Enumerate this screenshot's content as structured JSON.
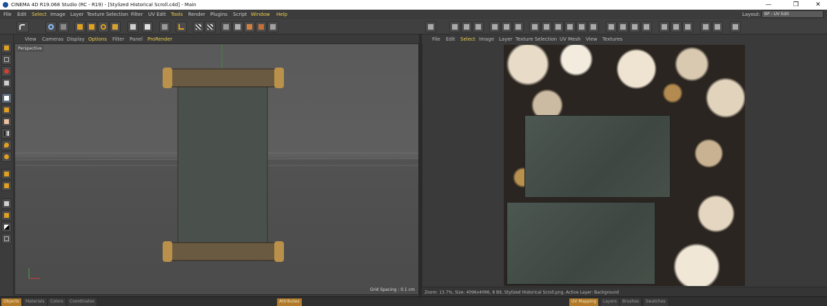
{
  "titlebar": {
    "title": "CINEMA 4D R19.068 Studio (RC - R19) - [Stylized Historical Scroll.c4d] - Main",
    "minimize": "—",
    "restore": "❐",
    "close": "✕"
  },
  "menubar": {
    "items": [
      "File",
      "Edit",
      "Select",
      "Image",
      "Layer",
      "Texture Selection",
      "Filter",
      "UV Edit",
      "Tools",
      "Render",
      "Plugins",
      "Script",
      "Window",
      "Help"
    ],
    "layout_label": "Layout:",
    "layout_value": "BP - UV Edit"
  },
  "viewport": {
    "menu": [
      "View",
      "Cameras",
      "Display",
      "Options",
      "Filter",
      "Panel",
      "ProRender"
    ],
    "label": "Perspective",
    "grid_spacing": "Grid Spacing : 0.1 cm"
  },
  "uv_editor": {
    "menu": [
      "File",
      "Edit",
      "Select",
      "Image",
      "Layer",
      "Texture Selection",
      "UV Mesh",
      "View",
      "Textures"
    ],
    "status": "Zoom: 13.7%, Size: 4096x4096, 8 Bit, Stylized Historical Scroll.png, Active Layer: Background"
  },
  "bottom_tabs": [
    "Objects",
    "Materials",
    "Colors",
    "Coordinates",
    "Attributes",
    "UV Mapping",
    "Layers",
    "Brushes",
    "Swatches"
  ],
  "colors": {
    "accent": "#b07a2a",
    "highlight": "#f0d050",
    "bg": "#3a3a3a"
  }
}
